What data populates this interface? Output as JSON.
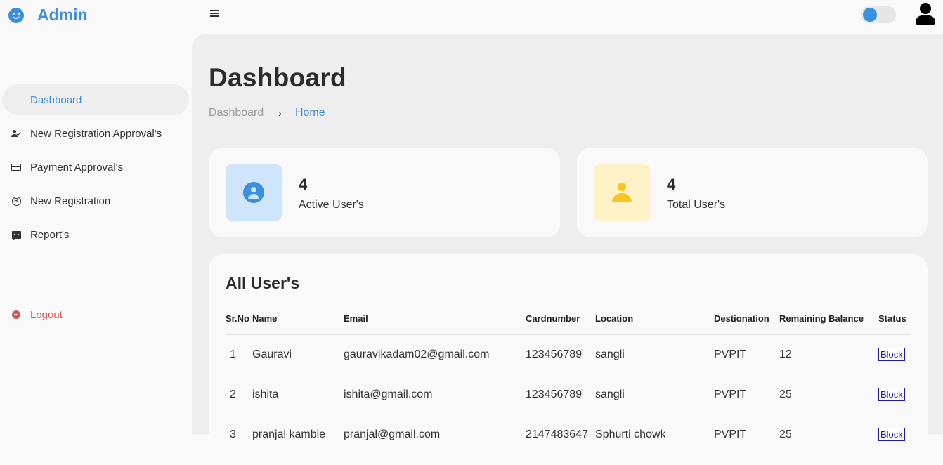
{
  "app": {
    "title": "Admin"
  },
  "sidebar": {
    "items": [
      {
        "label": "Dashboard",
        "icon": "dashboard-grid-icon",
        "active": true
      },
      {
        "label": "New Registration Approval's",
        "icon": "user-check-icon"
      },
      {
        "label": "Payment Approval's",
        "icon": "credit-card-icon"
      },
      {
        "label": "New Registration",
        "icon": "registered-icon"
      },
      {
        "label": "Report's",
        "icon": "chat-report-icon"
      }
    ],
    "logout": {
      "label": "Logout",
      "icon": "logout-icon"
    }
  },
  "page": {
    "title": "Dashboard",
    "breadcrumb": [
      "Dashboard",
      "Home"
    ]
  },
  "stats": [
    {
      "value": "4",
      "label": "Active User's",
      "color": "#3b8fe0"
    },
    {
      "value": "4",
      "label": "Total User's",
      "color": "#f6c624"
    }
  ],
  "users_table": {
    "title": "All User's",
    "columns": [
      "Sr.No",
      "Name",
      "Email",
      "Cardnumber",
      "Location",
      "Destionation",
      "Remaining Balance",
      "Status"
    ],
    "rows": [
      {
        "sr": "1",
        "name": "Gauravi",
        "email": "gauravikadam02@gmail.com",
        "card": "123456789",
        "location": "sangli",
        "destination": "PVPIT",
        "balance": "12",
        "action": "Block"
      },
      {
        "sr": "2",
        "name": "ishita",
        "email": "ishita@gmail.com",
        "card": "123456789",
        "location": "sangli",
        "destination": "PVPIT",
        "balance": "25",
        "action": "Block"
      },
      {
        "sr": "3",
        "name": "pranjal kamble",
        "email": "pranjal@gmail.com",
        "card": "2147483647",
        "location": "Sphurti chowk",
        "destination": "PVPIT",
        "balance": "25",
        "action": "Block"
      }
    ]
  },
  "colors": {
    "accent": "#3b8fe0",
    "logout": "#d9534f",
    "warning": "#f6c624"
  }
}
